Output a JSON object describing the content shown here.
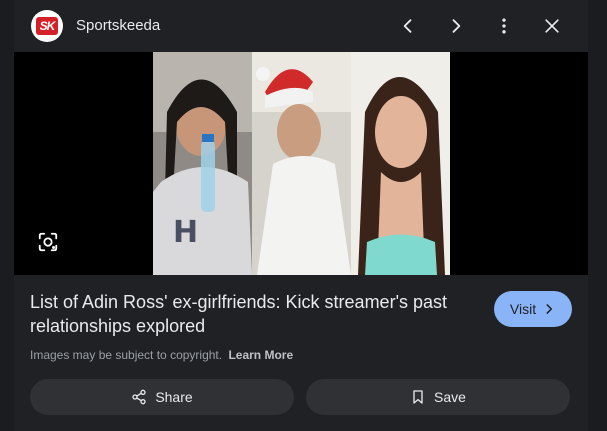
{
  "header": {
    "logo_text": "SK",
    "site_name": "Sportskeeda",
    "icons": {
      "prev": "chevron-left-icon",
      "next": "chevron-right-icon",
      "more": "more-vertical-icon",
      "close": "close-icon"
    }
  },
  "media": {
    "lens_icon": "google-lens-icon"
  },
  "result": {
    "title": "List of Adin Ross' ex-girlfriends: Kick streamer's past relationships explored",
    "visit_label": "Visit",
    "copyright_text": "Images may be subject to copyright.",
    "learn_more_label": "Learn More"
  },
  "actions": {
    "share_label": "Share",
    "save_label": "Save"
  },
  "colors": {
    "background": "#202124",
    "accent": "#8ab4f8",
    "button_bg": "#303134"
  }
}
